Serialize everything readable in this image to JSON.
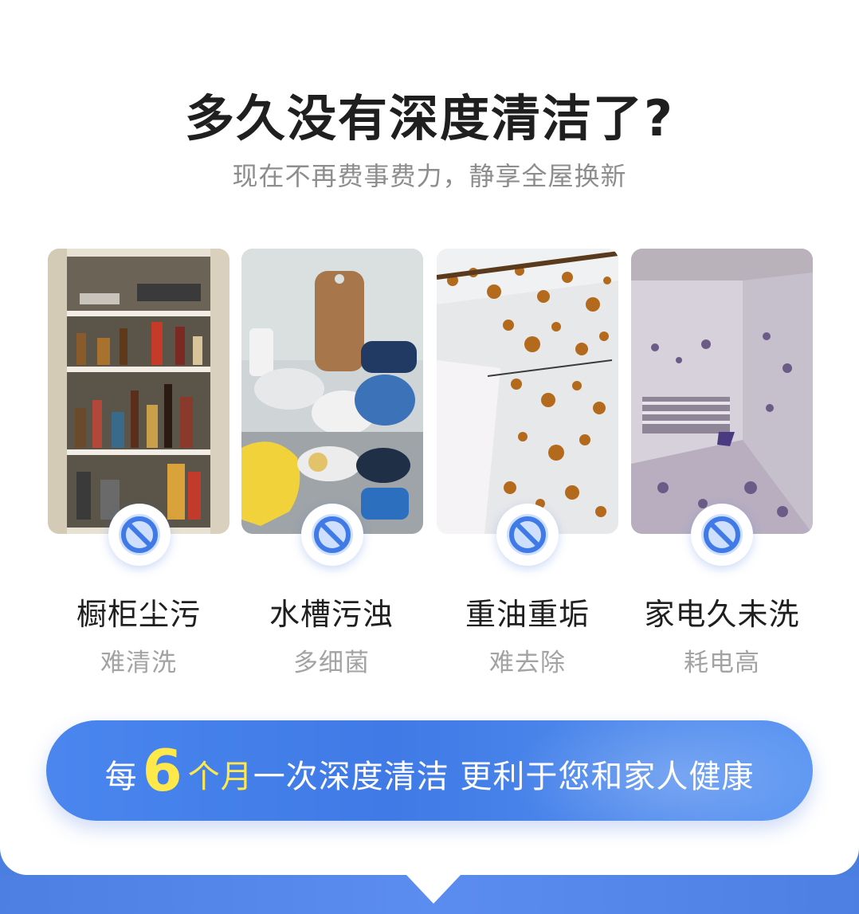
{
  "header": {
    "title": "多久没有深度清洁了?",
    "subtitle": "现在不再费事费力，静享全屋换新"
  },
  "problems": [
    {
      "title": "橱柜尘污",
      "sub": "难清洗",
      "icon": "ban-icon"
    },
    {
      "title": "水槽污浊",
      "sub": "多细菌",
      "icon": "ban-icon"
    },
    {
      "title": "重油重垢",
      "sub": "难去除",
      "icon": "ban-icon"
    },
    {
      "title": "家电久未洗",
      "sub": "耗电高",
      "icon": "ban-icon"
    }
  ],
  "banner": {
    "prefix": "每",
    "number": "6",
    "unit": "个月",
    "text": "一次深度清洁 更利于您和家人健康"
  },
  "colors": {
    "accent": "#4a86ee",
    "highlight": "#ffe84a",
    "title": "#1f1f1f",
    "muted": "#a3a3a3"
  }
}
